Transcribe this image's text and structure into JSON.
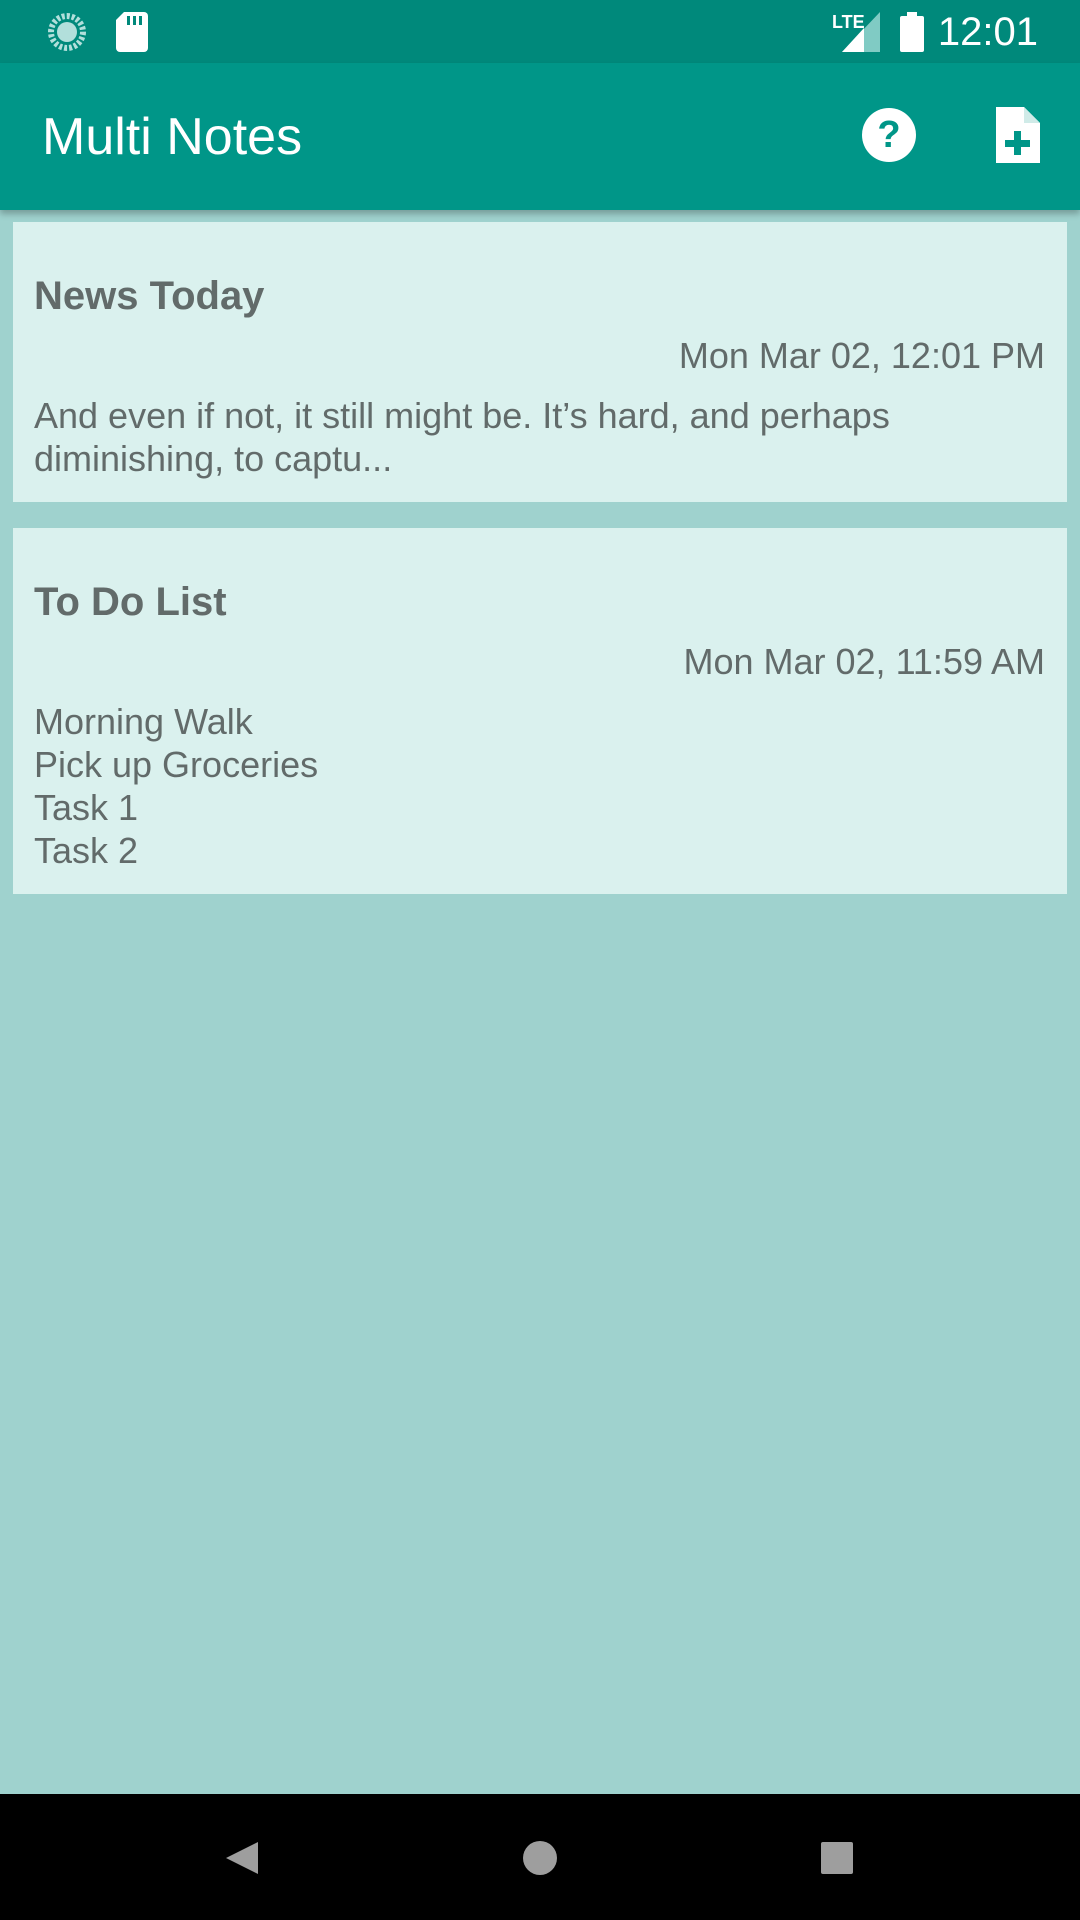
{
  "status_bar": {
    "time": "12:01",
    "network_label": "LTE",
    "icons": [
      "sync-icon",
      "sd-card-icon",
      "signal-icon",
      "battery-icon"
    ]
  },
  "app_bar": {
    "title": "Multi Notes",
    "actions": [
      "help-icon",
      "add-note-icon"
    ]
  },
  "notes": [
    {
      "title": "News Today",
      "date": "Mon Mar 02, 12:01 PM",
      "body": "And even if not, it still might be. It’s hard, and perhaps diminishing, to captu..."
    },
    {
      "title": "To Do List",
      "date": "Mon Mar 02, 11:59 AM",
      "body": "Morning Walk\nPick up Groceries\nTask 1\nTask 2"
    }
  ],
  "nav_bar": {
    "buttons": [
      "back-icon",
      "home-icon",
      "recents-icon"
    ]
  },
  "colors": {
    "status_bar": "#00897b",
    "app_bar": "#009688",
    "background": "#9fd2ce",
    "card": "#daf1ee",
    "text": "#626b6a"
  }
}
